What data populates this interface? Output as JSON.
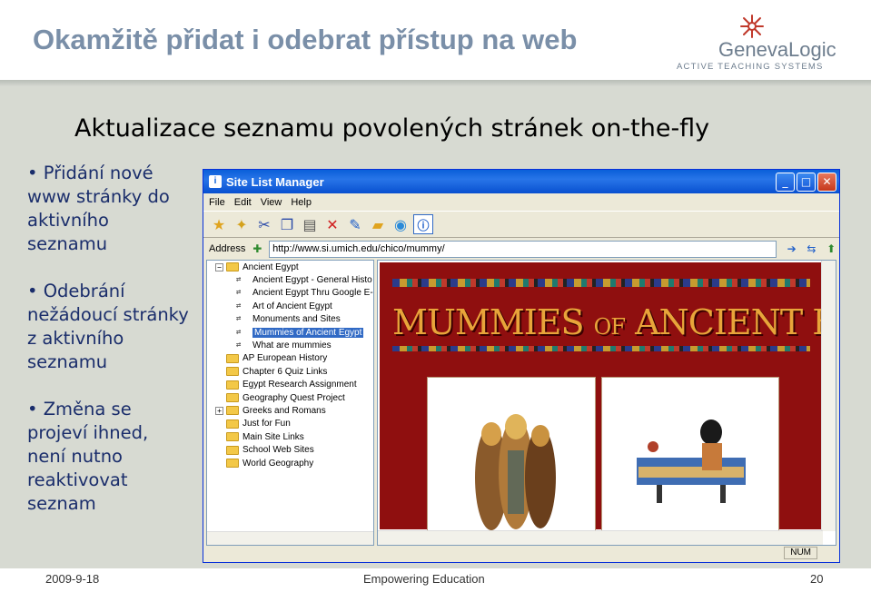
{
  "slide": {
    "title": "Okamžitě přidat i odebrat přístup na web",
    "subtitle": "Aktualizace seznamu povolených stránek  on-the-fly",
    "bullets": [
      "Přidání nové www stránky do aktivního seznamu",
      "Odebrání nežádoucí stránky z aktivního seznamu",
      "Změna se projeví ihned, není nutno reaktivovat seznam"
    ]
  },
  "logo": {
    "name": "GenevaLogic",
    "tagline": "Active Teaching Systems"
  },
  "footer": {
    "date": "2009-9-18",
    "center": "Empowering Education",
    "page": "20"
  },
  "window": {
    "title": "Site List Manager",
    "menu": [
      "File",
      "Edit",
      "View",
      "Help"
    ],
    "toolbar_icons": [
      "new-folder-icon",
      "new-item-icon",
      "cut-icon",
      "copy-icon",
      "paste-icon",
      "delete-icon",
      "properties-icon",
      "open-icon",
      "import-icon",
      "info-icon"
    ],
    "address_label": "Address",
    "address_value": "http://www.si.umich.edu/chico/mummy/",
    "status": "NUM"
  },
  "tree": {
    "root": "Ancient Egypt",
    "children": [
      "Ancient Egypt - General Histo",
      "Ancient Egypt Thru Google E-",
      "Art of Ancient Egypt",
      "Monuments and Sites",
      "Mummies of Ancient Egypt",
      "What are mummies"
    ],
    "selected": "Mummies of Ancient Egypt",
    "folders": [
      "AP European History",
      "Chapter 6 Quiz Links",
      "Egypt Research Assignment",
      "Geography Quest Project",
      "Greeks and Romans",
      "Just for Fun",
      "Main Site Links",
      "School Web Sites",
      "World Geography"
    ]
  },
  "preview": {
    "banner_a": "MUMMIES",
    "banner_b": "OF",
    "banner_c": "ANCIENT EGYPT"
  }
}
